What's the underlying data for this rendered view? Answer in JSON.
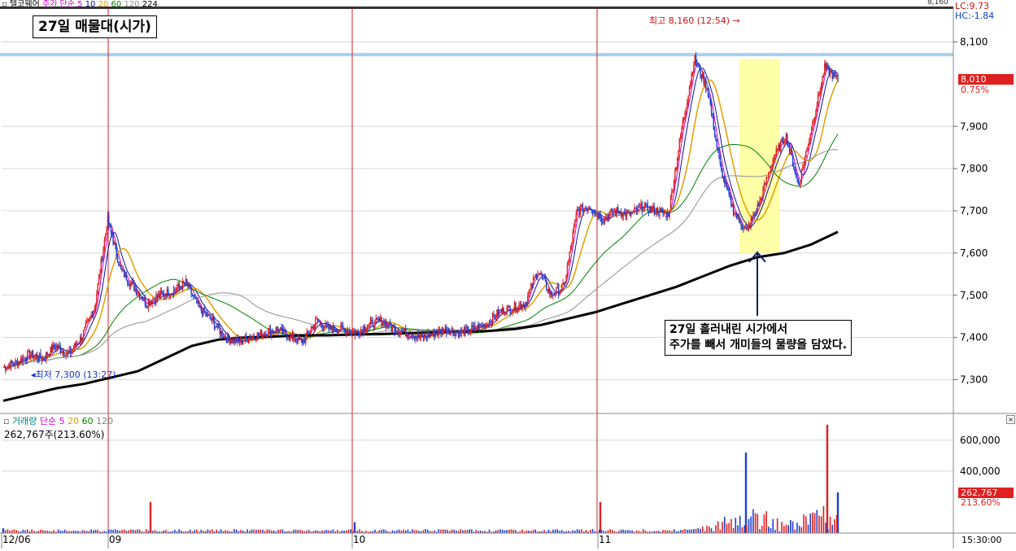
{
  "header": {
    "stock_name": "텔코웨어",
    "legend_prefix": "주가 단순 5",
    "ma_labels": [
      "10",
      "20",
      "60",
      "120",
      "224"
    ],
    "top_right_price": "8,160"
  },
  "annotations": {
    "title_box": "27일 매물대(시가)",
    "high_label": "최고 8,160 (12:54) →",
    "low_label": "최저 7,300 (13:27)",
    "note_line1": "27일 흘러내린 시가에서",
    "note_line2": "주가를 빼서 개미들의 물량을 담았다."
  },
  "right_panel": {
    "lc": "LC:9.73",
    "hc": "HC:-1.84",
    "price_tag": "8,010",
    "price_change": "0.75%",
    "volume_tag": "262,767",
    "volume_change": "213.60%",
    "time_label": "15:30:00"
  },
  "volume_panel": {
    "legend": [
      "거래량",
      "단순 5",
      "20",
      "60",
      "120"
    ],
    "legend_colors": [
      "#008080",
      "#d000d0",
      "#e0a000",
      "#008000",
      "#808080"
    ],
    "current_value": "262,767주(213.60%)"
  },
  "colors": {
    "up": "#e02020",
    "down": "#2040d0",
    "ma5": "#d000d0",
    "ma10": "#1010a0",
    "ma20": "#e0a000",
    "ma60": "#008000",
    "ma120": "#909090",
    "ma224": "#000000",
    "highlight": "#ffff99",
    "resistance": "#a8d0f0",
    "divider": "#d02020"
  },
  "chart_data": [
    {
      "type": "line",
      "title": "",
      "x": [
        "12/06",
        "09",
        "10",
        "11"
      ],
      "ylim": [
        7220,
        8180
      ],
      "y_ticks": [
        7300,
        7400,
        7500,
        7600,
        7700,
        7800,
        7900,
        8100
      ],
      "y_tick_labels": [
        "7,300",
        "7,400",
        "7,500",
        "7,600",
        "7,700",
        "7,800",
        "7,900",
        "8,100"
      ],
      "grid": true,
      "high": 8160,
      "low": 7300,
      "last": 8010,
      "resistance_level": 8070,
      "series": [
        {
          "name": "주가",
          "values": [
            7330,
            7340,
            7360,
            7350,
            7380,
            7360,
            7400,
            7470,
            7680,
            7560,
            7520,
            7480,
            7500,
            7510,
            7530,
            7470,
            7440,
            7400,
            7390,
            7400,
            7410,
            7420,
            7400,
            7390,
            7440,
            7420,
            7420,
            7410,
            7430,
            7440,
            7420,
            7410,
            7400,
            7410,
            7420,
            7410,
            7420,
            7430,
            7460,
            7470,
            7480,
            7560,
            7500,
            7520,
            7700,
            7710,
            7680,
            7700,
            7690,
            7710,
            7700,
            7690,
            7890,
            8060,
            7990,
            7800,
            7700,
            7650,
            7720,
            7820,
            7880,
            7760,
            7900,
            8040,
            8010
          ]
        },
        {
          "name": "224",
          "values": [
            7250,
            7265,
            7280,
            7290,
            7305,
            7320,
            7350,
            7380,
            7395,
            7400,
            7402,
            7405,
            7405,
            7407,
            7408,
            7410,
            7412,
            7414,
            7415,
            7420,
            7430,
            7445,
            7460,
            7480,
            7500,
            7520,
            7545,
            7570,
            7590,
            7600,
            7620,
            7650
          ]
        }
      ]
    },
    {
      "type": "bar",
      "title": "",
      "ylim": [
        0,
        720000
      ],
      "y_ticks": [
        400000,
        600000
      ],
      "y_tick_labels": [
        "400,000",
        "600,000"
      ],
      "last": 262767,
      "peaks": [
        {
          "x": "12/06",
          "value": 30000
        },
        {
          "x": "09",
          "value": 200000
        },
        {
          "x": "10",
          "value": 70000
        },
        {
          "x": "11",
          "value": 200000
        },
        {
          "x": "11",
          "value": 520000
        },
        {
          "x": "11",
          "value": 700000
        },
        {
          "x": "11",
          "value": 262767
        }
      ]
    }
  ]
}
